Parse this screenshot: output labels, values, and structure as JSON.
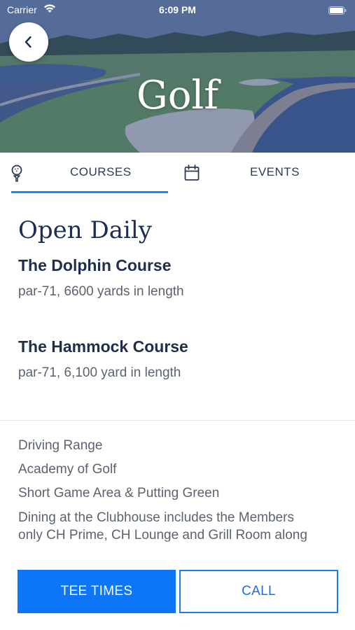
{
  "status_bar": {
    "carrier": "Carrier",
    "time": "6:09 PM"
  },
  "header": {
    "title": "Golf",
    "back_icon": "chevron-left-icon"
  },
  "tabs": [
    {
      "label": "COURSES",
      "icon": "golf-ball-tee-icon",
      "selected": true
    },
    {
      "label": "EVENTS",
      "icon": "calendar-icon",
      "selected": false
    }
  ],
  "hours": {
    "title": "Open Daily"
  },
  "courses": [
    {
      "name": "The Dolphin Course",
      "detail": "par-71, 6600 yards in length"
    },
    {
      "name": "The Hammock Course",
      "detail": "par-71, 6,100 yard in length"
    }
  ],
  "amenities": [
    "Driving Range",
    "Academy of Golf",
    "Short Game Area & Putting Green",
    "Dining at the Clubhouse includes the Members",
    "only CH Prime, CH Lounge and Grill Room along"
  ],
  "actions": {
    "tee_times": "TEE TIMES",
    "call": "CALL"
  },
  "colors": {
    "accent": "#0d76f7",
    "title_navy": "#1c2d55",
    "body_text": "#5b6370"
  }
}
